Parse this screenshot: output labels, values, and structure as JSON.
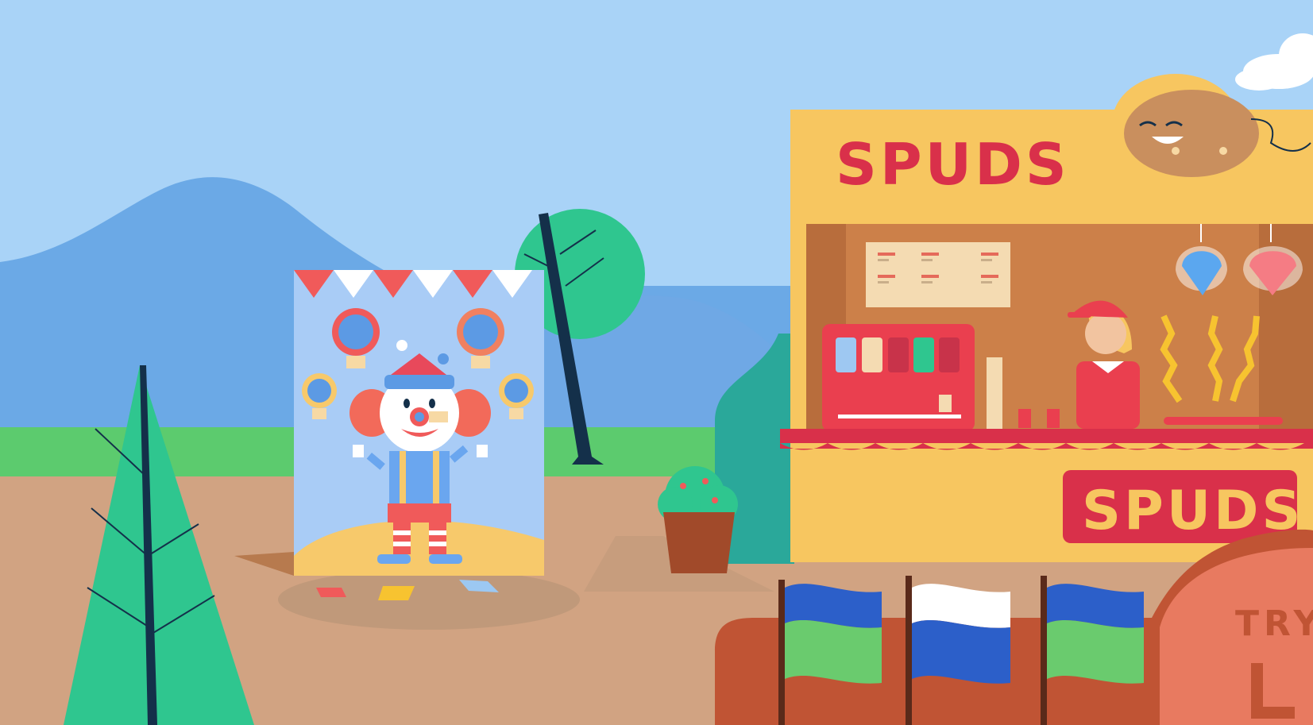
{
  "scene": {
    "booth_sign_top": "SPUDS",
    "booth_sign_front": "SPUDS",
    "side_sign_partial": "TRY"
  },
  "colors": {
    "sky": "#a9d3f7",
    "mountain": "#6ba9e6",
    "grass": "#5ccb6e",
    "ground": "#d1a382",
    "booth_yellow": "#f7c660",
    "booth_red": "#e0394b",
    "tree_green": "#2fc68f",
    "flag_blue": "#2c5fc9",
    "flag_green": "#6acb6e",
    "clown_board": "#a9ccf6"
  },
  "icons": [
    "clown-icon",
    "potato-mascot-icon",
    "cotton-candy-icon",
    "soda-dispenser-icon",
    "flag-icon",
    "tree-icon",
    "bush-icon",
    "cloud-icon"
  ]
}
